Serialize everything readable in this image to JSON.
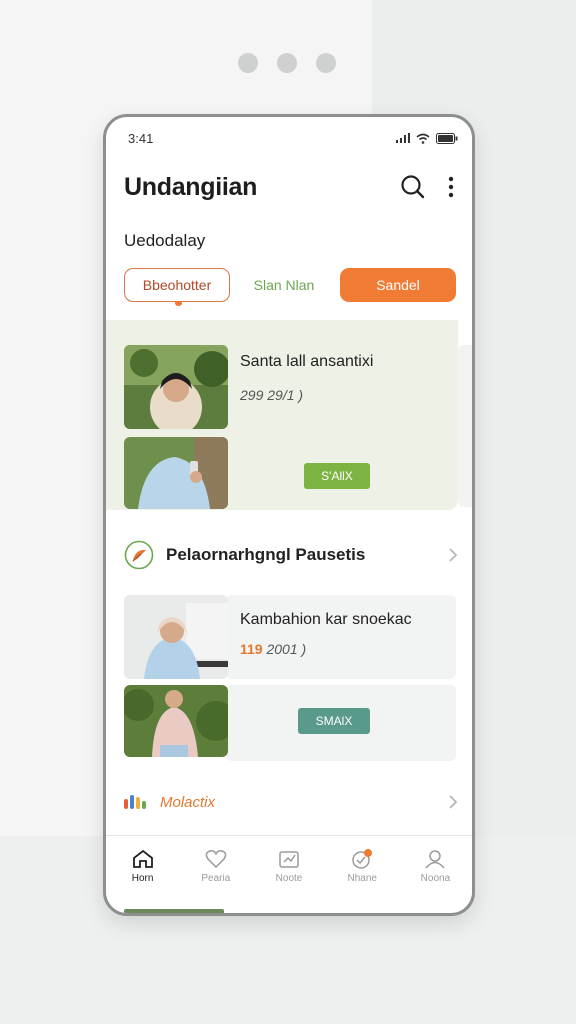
{
  "status": {
    "time": "3:41"
  },
  "header": {
    "title": "Undangiian",
    "icons": [
      "search-icon",
      "more-icon"
    ]
  },
  "subtitle": "Uedodalay",
  "chips": [
    "Bbeohotter",
    "Slan Nlan",
    "Sandel"
  ],
  "section1": {
    "card_title": "Santa lall ansantixi",
    "card_meta": "299 29/1 )",
    "badge": "S'AllX",
    "badge_color": "#7cb342"
  },
  "section2_row": {
    "title": "Pelaornarhgngl Pausetis",
    "icon": "leaf-icon"
  },
  "section2_card": {
    "card_title": "Kambahion kar snoekac",
    "card_meta_highlight": "119",
    "card_meta": "2001 )",
    "badge": "SMAlX",
    "badge_color": "#5a9a8c"
  },
  "row3": {
    "label": "Molactix",
    "icon": "app-logo-icon"
  },
  "nav": [
    {
      "label": "Horn",
      "icon": "home-icon",
      "active": true
    },
    {
      "label": "Pearia",
      "icon": "heart-icon",
      "active": false
    },
    {
      "label": "Noote",
      "icon": "chart-icon",
      "active": false
    },
    {
      "label": "Nhane",
      "icon": "notification-icon",
      "active": false
    },
    {
      "label": "Noona",
      "icon": "profile-icon",
      "active": false
    }
  ],
  "colors": {
    "accent": "#ef7b35",
    "green": "#6aa84f"
  }
}
